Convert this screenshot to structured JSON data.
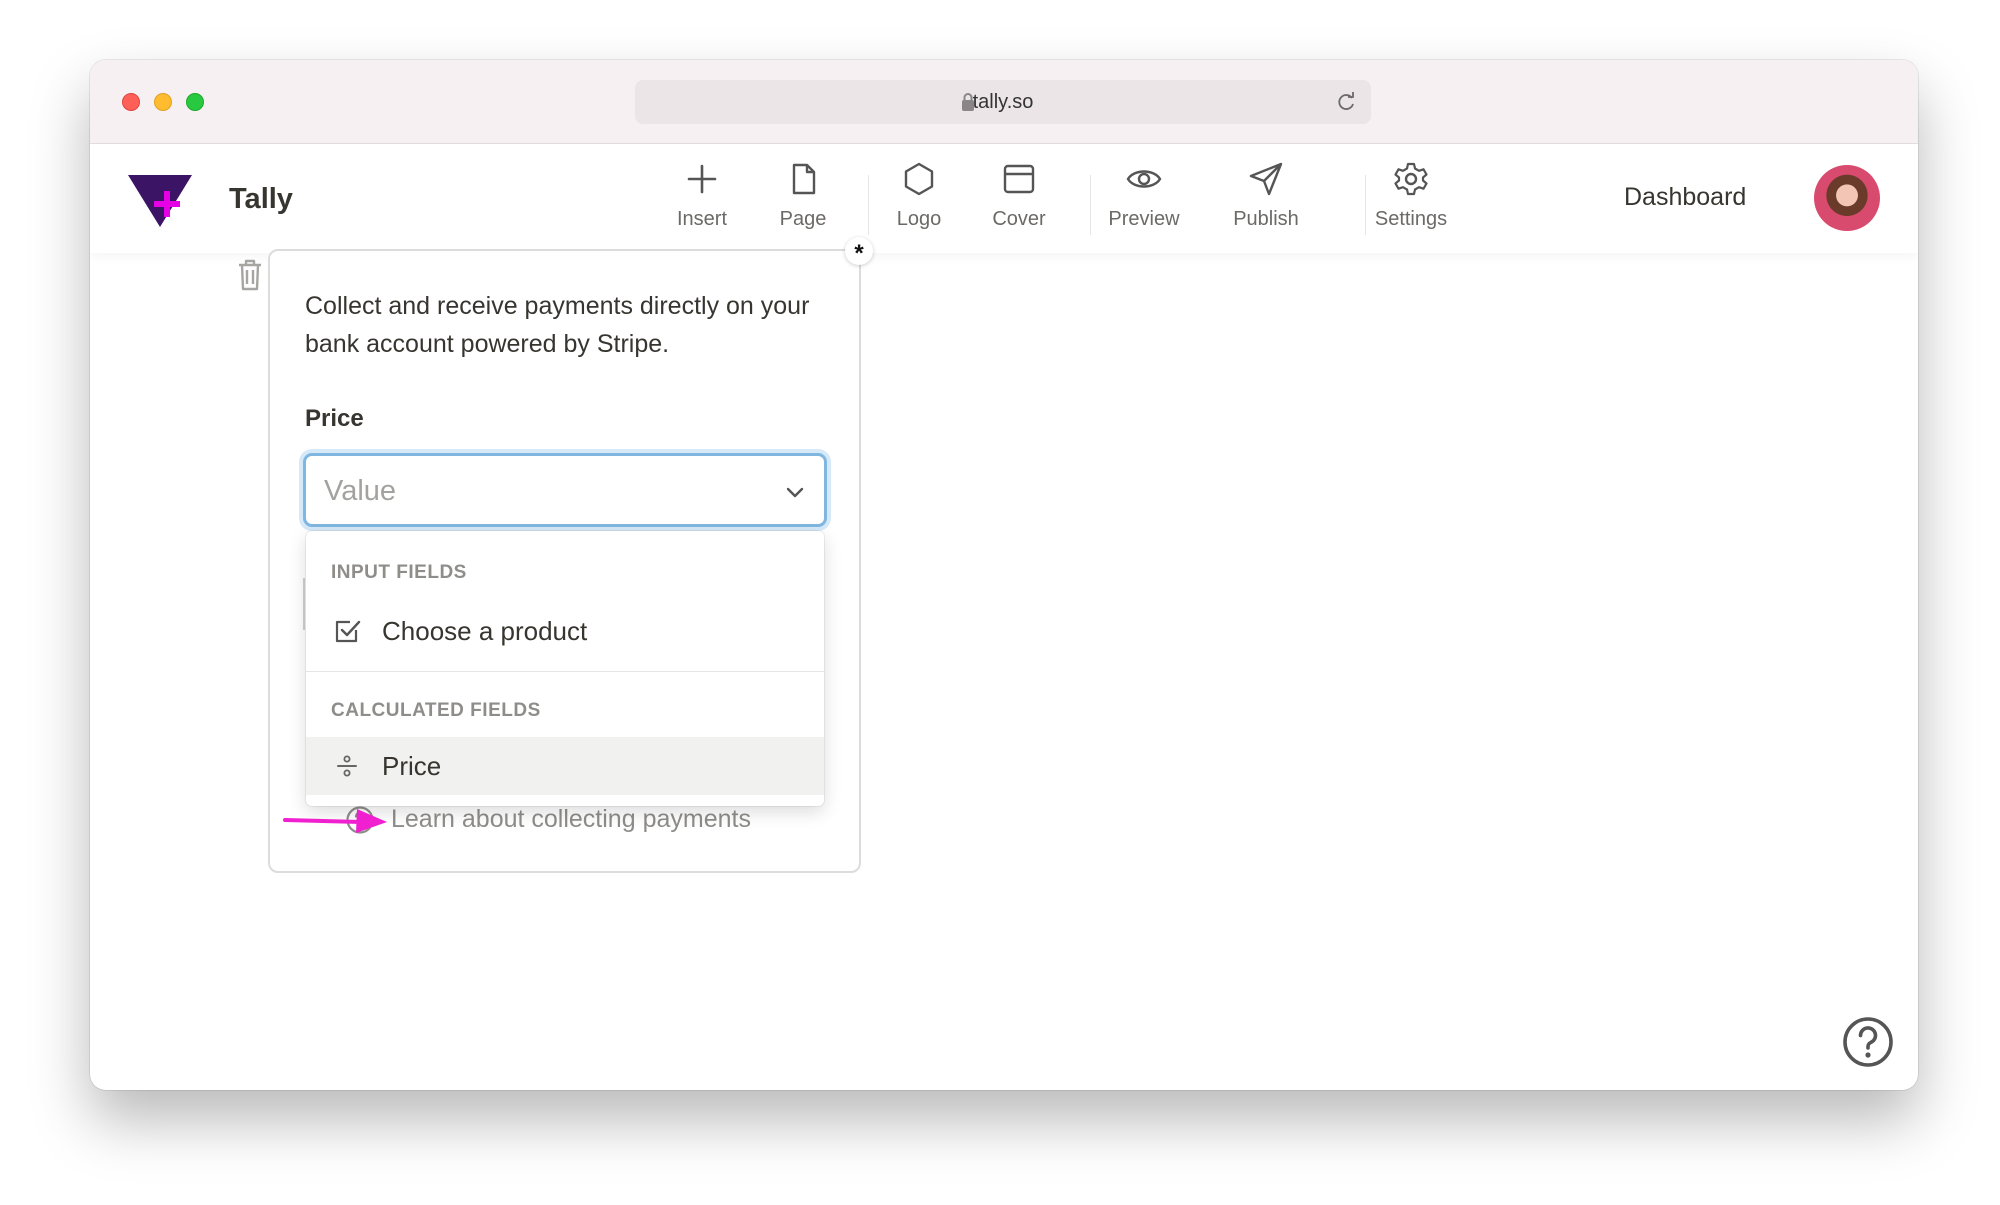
{
  "browser": {
    "url": "tally.so"
  },
  "app": {
    "brand": "Tally",
    "dashboard_label": "Dashboard",
    "accent_color": "#e600e6",
    "logo_color": "#4a1a7a"
  },
  "toolbar": {
    "items": [
      {
        "label": "Insert",
        "icon": "plus-icon"
      },
      {
        "label": "Page",
        "icon": "page-icon"
      },
      {
        "label": "Logo",
        "icon": "hexagon-icon"
      },
      {
        "label": "Cover",
        "icon": "cover-icon"
      },
      {
        "label": "Preview",
        "icon": "eye-icon"
      },
      {
        "label": "Publish",
        "icon": "send-icon"
      },
      {
        "label": "Settings",
        "icon": "gear-icon"
      }
    ]
  },
  "payment_block": {
    "required_marker": "*",
    "description": "Collect and receive payments directly on your bank account powered by Stripe.",
    "price_label": "Price",
    "select_placeholder": "Value",
    "help_link": "Learn about collecting payments"
  },
  "dropdown": {
    "sections": [
      {
        "heading": "INPUT FIELDS",
        "items": [
          {
            "label": "Choose a product",
            "icon": "checkbox-icon"
          }
        ]
      },
      {
        "heading": "CALCULATED FIELDS",
        "items": [
          {
            "label": "Price",
            "icon": "divide-icon",
            "highlighted": true
          }
        ]
      }
    ]
  },
  "annotation": {
    "arrow_color": "#f020d0"
  }
}
